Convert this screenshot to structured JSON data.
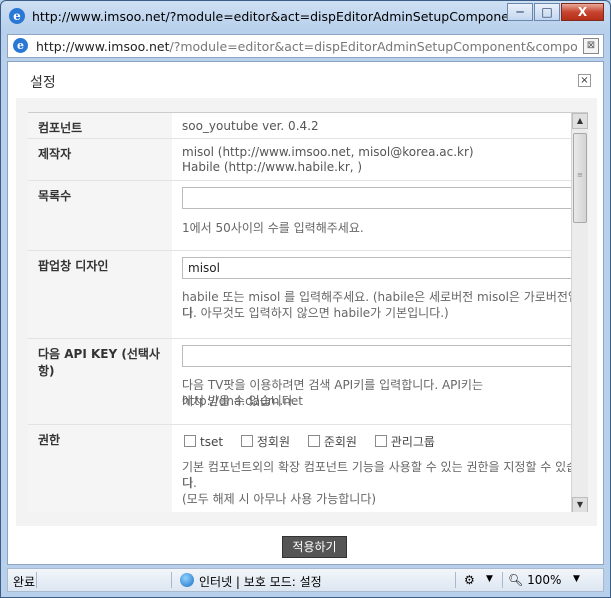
{
  "window": {
    "title": "http://www.imsoo.net/?module=editor&act=dispEditorAdminSetupComponent&com...",
    "buttons": {
      "minimize": "─",
      "maximize": "□",
      "close": "X"
    }
  },
  "address": {
    "url_host": "http://www.imsoo.net",
    "url_rest": "/?module=editor&act=dispEditorAdminSetupComponent&component_name="
  },
  "dialog": {
    "title": "설정",
    "close": "×",
    "rows": {
      "component": {
        "label": "컴포넌트",
        "value": "soo_youtube ver. 0.4.2"
      },
      "author": {
        "label": "제작자",
        "line1": "misol (http://www.imsoo.net, misol@korea.ac.kr)",
        "line2": "Habile (http://www.habile.kr, )"
      },
      "list_count": {
        "label": "목록수",
        "value": "",
        "help": "1에서 50사이의 수를 입력해주세요."
      },
      "popup_design": {
        "label": "팝업창 디자인",
        "value": "misol",
        "help1": "habile 또는 misol 를 입력해주세요. (habile은 세로버전 misol은 가로버전입니",
        "help2": "다. 아무것도 입력하지 않으면 habile가 기본입니다.)"
      },
      "daum_api": {
        "label": "다음 API KEY (선택사항)",
        "value": "",
        "help1": "다음 TV팟을 이용하려면 검색 API키를 입력합니다. API키는 http://dna.daum.net",
        "help2": "에서 받을 수 있습니다."
      },
      "permission": {
        "label": "권한",
        "options": [
          "tset",
          "정회원",
          "준회원",
          "관리그룹"
        ],
        "help1": "기본 컴포넌트외의 확장 컴포넌트 기능을 사용할 수 있는 권한을 지정할 수 있습니",
        "help2": "다.",
        "help3": "(모두 해제 시 아무나 사용 가능합니다)"
      }
    },
    "apply_button": "적용하기"
  },
  "statusbar": {
    "left": "완료",
    "zone": "인터넷 | 보호 모드: 설정",
    "zoom": "100%"
  }
}
